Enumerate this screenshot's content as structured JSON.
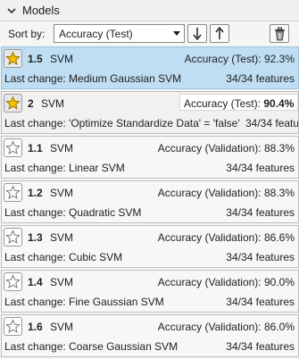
{
  "header": {
    "title": "Models"
  },
  "toolbar": {
    "sort_label": "Sort by:",
    "sort_value": "Accuracy (Test)",
    "sort_desc_icon": "sort-descending-icon",
    "sort_asc_icon": "sort-ascending-icon",
    "delete_icon": "trash-icon"
  },
  "models": [
    {
      "number": "1.5",
      "type": "SVM",
      "metric_label": "Accuracy (Test):",
      "metric_value": "92.3%",
      "last_change": "Last change: Medium Gaussian SVM",
      "features": "34/34 features",
      "starred": true,
      "selected": true
    },
    {
      "number": "2",
      "type": "SVM",
      "metric_label": "Accuracy (Test):",
      "metric_value": "90.4%",
      "last_change": "Last change: 'Optimize Standardize Data' = 'false'",
      "features": "34/34 featu",
      "starred": true,
      "selected": false
    },
    {
      "number": "1.1",
      "type": "SVM",
      "metric_label": "Accuracy (Validation):",
      "metric_value": "88.3%",
      "last_change": "Last change: Linear SVM",
      "features": "34/34 features",
      "starred": false,
      "selected": false
    },
    {
      "number": "1.2",
      "type": "SVM",
      "metric_label": "Accuracy (Validation):",
      "metric_value": "88.3%",
      "last_change": "Last change: Quadratic SVM",
      "features": "34/34 features",
      "starred": false,
      "selected": false
    },
    {
      "number": "1.3",
      "type": "SVM",
      "metric_label": "Accuracy (Validation):",
      "metric_value": "86.6%",
      "last_change": "Last change: Cubic SVM",
      "features": "34/34 features",
      "starred": false,
      "selected": false
    },
    {
      "number": "1.4",
      "type": "SVM",
      "metric_label": "Accuracy (Validation):",
      "metric_value": "90.0%",
      "last_change": "Last change: Fine Gaussian SVM",
      "features": "34/34 features",
      "starred": false,
      "selected": false
    },
    {
      "number": "1.6",
      "type": "SVM",
      "metric_label": "Accuracy (Validation):",
      "metric_value": "86.0%",
      "last_change": "Last change: Coarse Gaussian SVM",
      "features": "34/34 features",
      "starred": false,
      "selected": false
    }
  ],
  "colors": {
    "selected": "#bfdef3",
    "star": "#f5c000",
    "border": "#bdbdbd"
  }
}
